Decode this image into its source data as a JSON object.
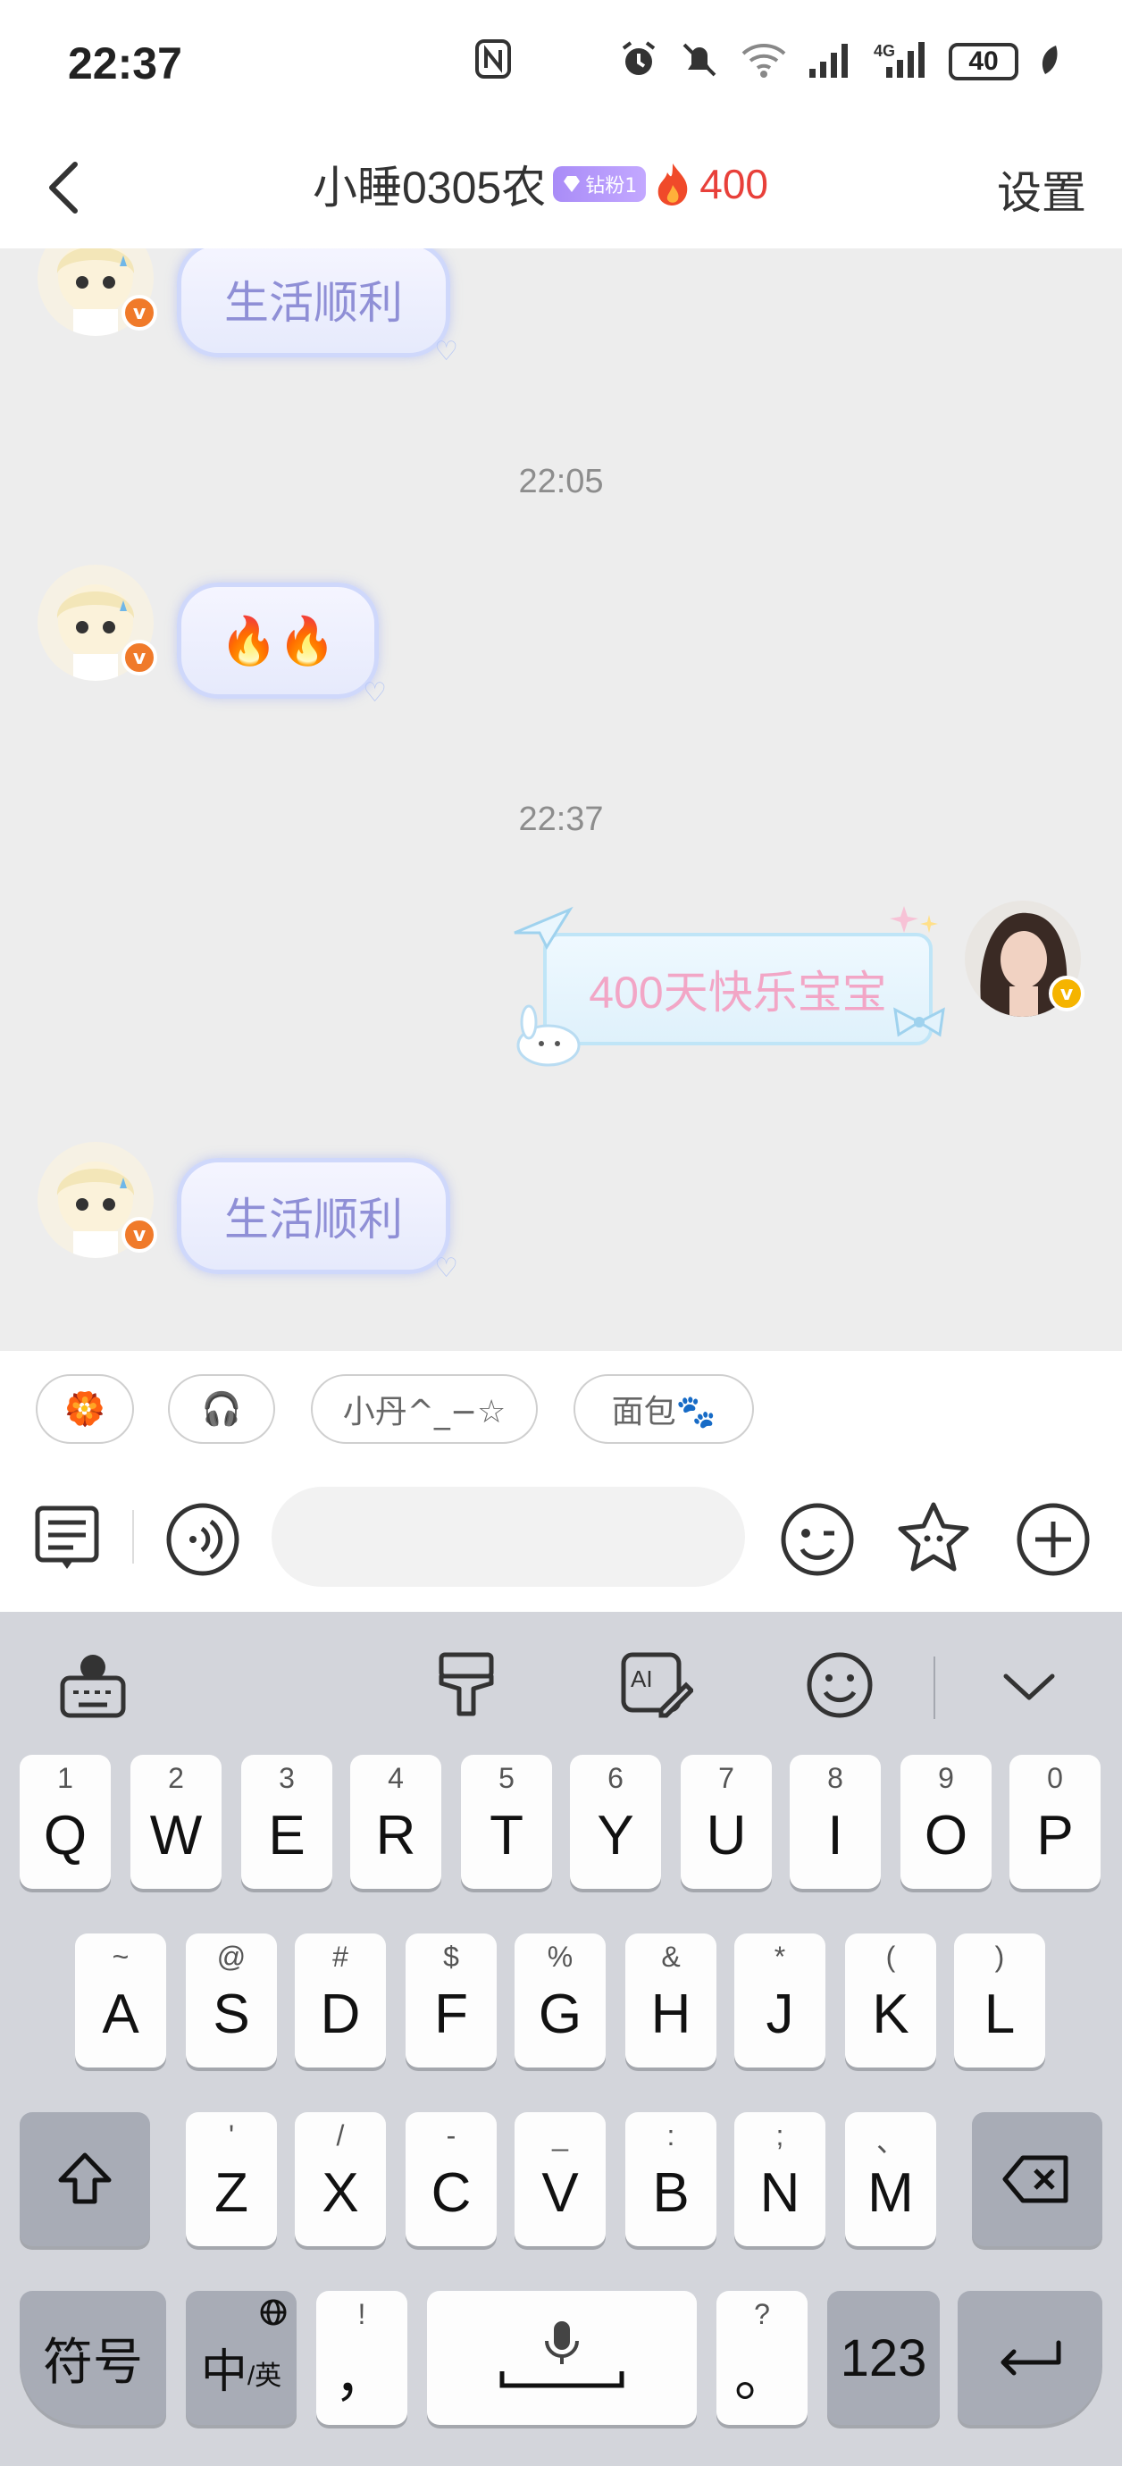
{
  "status_bar": {
    "time": "22:37",
    "battery": "40"
  },
  "header": {
    "title": "小睡0305农",
    "fan_badge": "钻粉1",
    "fire_count": "400",
    "settings": "设置"
  },
  "chat": {
    "messages": [
      {
        "side": "left",
        "text": "生活顺利"
      },
      {
        "timestamp": "22:05"
      },
      {
        "side": "left",
        "text": "🔥🔥"
      },
      {
        "timestamp": "22:37"
      },
      {
        "side": "right",
        "text": "400天快乐宝宝"
      },
      {
        "side": "left",
        "text": "生活顺利"
      }
    ]
  },
  "quick_replies": [
    "🏵️",
    "🎧",
    "小丹^_−☆",
    "面包🐾"
  ],
  "input": {
    "placeholder": ""
  },
  "keyboard": {
    "row1": [
      [
        "Q",
        "1"
      ],
      [
        "W",
        "2"
      ],
      [
        "E",
        "3"
      ],
      [
        "R",
        "4"
      ],
      [
        "T",
        "5"
      ],
      [
        "Y",
        "6"
      ],
      [
        "U",
        "7"
      ],
      [
        "I",
        "8"
      ],
      [
        "O",
        "9"
      ],
      [
        "P",
        "0"
      ]
    ],
    "row2": [
      [
        "A",
        "~"
      ],
      [
        "S",
        "@"
      ],
      [
        "D",
        "#"
      ],
      [
        "F",
        "$"
      ],
      [
        "G",
        "%"
      ],
      [
        "H",
        "&"
      ],
      [
        "J",
        "*"
      ],
      [
        "K",
        "("
      ],
      [
        "L",
        ")"
      ]
    ],
    "row3": [
      [
        "Z",
        "'"
      ],
      [
        "X",
        "/"
      ],
      [
        "C",
        "-"
      ],
      [
        "V",
        "_"
      ],
      [
        "B",
        ":"
      ],
      [
        "N",
        ";"
      ],
      [
        "M",
        "、"
      ]
    ],
    "symbols": "符号",
    "lang_main": "中",
    "lang_sub": "/英",
    "comma": "，",
    "comma_sub": "!",
    "period": "。",
    "period_sub": "?",
    "numbers": "123"
  },
  "colors": {
    "fire": "#e8403a",
    "bubble_text": "#8f8fd6",
    "right_text": "#f2a6c6",
    "vbadge_left": "#f07a2a",
    "vbadge_right": "#f5b400"
  }
}
